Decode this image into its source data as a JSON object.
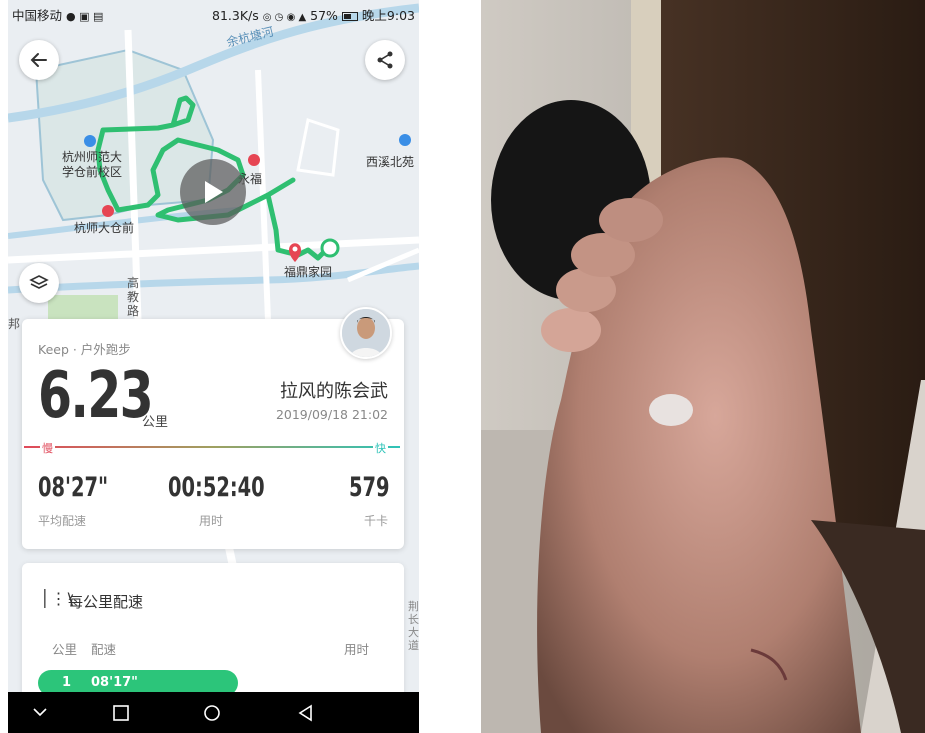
{
  "status_bar": {
    "carrier": "中国移动",
    "speed": "81.3K/s",
    "battery": "57%",
    "time": "晚上9:03"
  },
  "map": {
    "labels": {
      "canal": "余杭塘河",
      "campus": "杭州师范大学仓前校区",
      "campus_line1": "杭州师范大",
      "campus_line2": "学仓前校区",
      "station_west": "杭师大仓前",
      "station_mid": "永福",
      "station_east": "西溪北苑",
      "home": "福鼎家园",
      "road": "高教路",
      "road_chars": [
        "高",
        "教",
        "路"
      ],
      "edge_left": "邦",
      "right_edge": [
        "荆",
        "长",
        "大",
        "道"
      ]
    }
  },
  "summary": {
    "source": "Keep · 户外跑步",
    "distance": "6.23",
    "distance_unit": "公里",
    "user_name": "拉风的陈会武",
    "datetime": "2019/09/18 21:02",
    "scale_slow": "慢",
    "scale_fast": "快",
    "stats": [
      {
        "value": "08'27\"",
        "label": "平均配速"
      },
      {
        "value": "00:52:40",
        "label": "用时"
      },
      {
        "value": "579",
        "label": "千卡"
      }
    ]
  },
  "pace_section": {
    "title": "每公里配速",
    "col_km": "公里",
    "col_pace": "配速",
    "col_time": "用时",
    "rows": [
      {
        "km": "1",
        "pace": "08'17\""
      }
    ]
  },
  "colors": {
    "route": "#2fbf71",
    "accent_green": "#2cc57a",
    "slow_red": "#e0495a",
    "fast_teal": "#2ec3b8"
  },
  "icons": [
    "back-arrow-icon",
    "share-icon",
    "layers-icon",
    "play-icon",
    "pace-icon",
    "nav-back-icon",
    "nav-home-icon",
    "nav-recent-icon",
    "nav-collapse-icon"
  ]
}
